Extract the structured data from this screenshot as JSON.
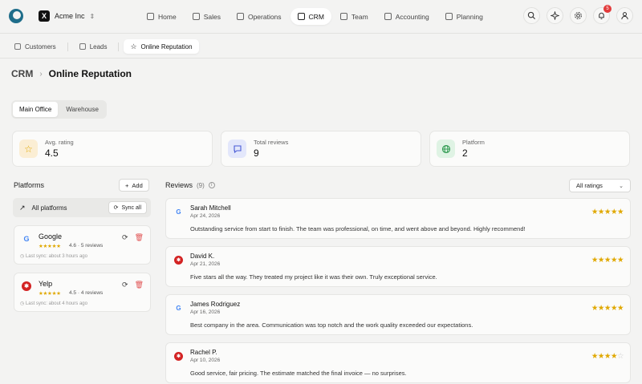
{
  "app": {
    "org_name": "Acme Inc",
    "org_letter": "X",
    "notification_count": "5"
  },
  "nav": [
    {
      "label": "Home",
      "active": false
    },
    {
      "label": "Sales",
      "active": false
    },
    {
      "label": "Operations",
      "active": false
    },
    {
      "label": "CRM",
      "active": true
    },
    {
      "label": "Team",
      "active": false
    },
    {
      "label": "Accounting",
      "active": false
    },
    {
      "label": "Planning",
      "active": false
    }
  ],
  "subtabs": [
    {
      "label": "Customers",
      "active": false
    },
    {
      "label": "Leads",
      "active": false
    },
    {
      "label": "Online Reputation",
      "active": true
    }
  ],
  "breadcrumb": {
    "section": "CRM",
    "page": "Online Reputation"
  },
  "locations": [
    {
      "label": "Main Office",
      "active": true
    },
    {
      "label": "Warehouse",
      "active": false
    }
  ],
  "stats": [
    {
      "label": "Avg. rating",
      "value": "4.5",
      "icon": "star-icon",
      "color": "#fbeed4"
    },
    {
      "label": "Total reviews",
      "value": "9",
      "icon": "message-icon",
      "color": "#e3e7fb"
    },
    {
      "label": "Platform",
      "value": "2",
      "icon": "globe-icon",
      "color": "#dff3e4"
    }
  ],
  "platforms": {
    "title": "Platforms",
    "add_label": "Add",
    "all_label": "All platforms",
    "sync_all_label": "Sync all",
    "items": [
      {
        "name": "Google",
        "rating": "4.6",
        "reviews": "· 5 reviews",
        "stars": 5,
        "last_sync": "Last sync: about 3 hours ago",
        "icon": "google-icon"
      },
      {
        "name": "Yelp",
        "rating": "4.5",
        "reviews": "· 4 reviews",
        "stars": 5,
        "last_sync": "Last sync: about 4 hours ago",
        "icon": "yelp-icon"
      }
    ]
  },
  "reviews": {
    "title": "Reviews",
    "count": "(9)",
    "filter_label": "All ratings",
    "items": [
      {
        "platform": "google",
        "name": "Sarah Mitchell",
        "date": "Apr 24, 2026",
        "stars": 5,
        "text": "Outstanding service from start to finish. The team was professional, on time, and went above and beyond. Highly recommend!"
      },
      {
        "platform": "yelp",
        "name": "David K.",
        "date": "Apr 21, 2026",
        "stars": 5,
        "text": "Five stars all the way. They treated my project like it was their own. Truly exceptional service."
      },
      {
        "platform": "google",
        "name": "James Rodriguez",
        "date": "Apr 16, 2026",
        "stars": 5,
        "text": "Best company in the area. Communication was top notch and the work quality exceeded our expectations."
      },
      {
        "platform": "yelp",
        "name": "Rachel P.",
        "date": "Apr 10, 2026",
        "stars": 4,
        "text": "Good service, fair pricing. The estimate matched the final invoice — no surprises."
      }
    ]
  },
  "colors": {
    "accent": "#1e6d8a",
    "star": "#e0a800",
    "badge": "#e23b3b",
    "google_g": "#4285f4",
    "yelp": "#d32323"
  }
}
